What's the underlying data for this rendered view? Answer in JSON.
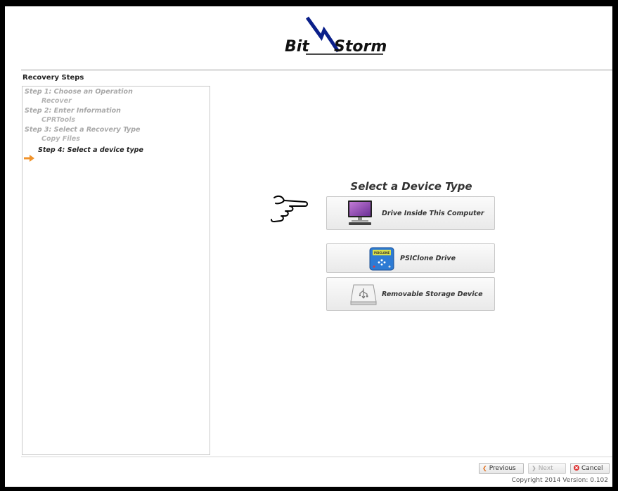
{
  "app": {
    "logo_text": "BitStorm"
  },
  "steps": {
    "title": "Recovery Steps",
    "items": [
      {
        "label": "Step 1: Choose an Operation",
        "kind": "step"
      },
      {
        "label": "Recover",
        "kind": "sub"
      },
      {
        "label": "Step 2: Enter Information",
        "kind": "step"
      },
      {
        "label": "CPRTools",
        "kind": "sub"
      },
      {
        "label": "Step 3: Select a Recovery Type",
        "kind": "step"
      },
      {
        "label": "Copy Files",
        "kind": "sub"
      },
      {
        "label": "Step 4: Select a device type",
        "kind": "current"
      }
    ],
    "current_indicator_icon": "arrow-right-icon",
    "accent_color": "#f0932b"
  },
  "main": {
    "title": "Select a Device Type",
    "devices": [
      {
        "label": "Drive Inside This Computer",
        "icon": "computer-monitor-icon"
      },
      {
        "label": "PSIClone Drive",
        "icon": "psiclone-device-icon",
        "icon_text": "PSICLONE"
      },
      {
        "label": "Removable Storage Device",
        "icon": "usb-drive-icon"
      }
    ],
    "pointer_icon": "pointing-hand-icon"
  },
  "footer": {
    "previous_label": "Previous",
    "next_label": "Next",
    "cancel_label": "Cancel",
    "copyright": "Copyright 2014 Version: 0.102"
  }
}
